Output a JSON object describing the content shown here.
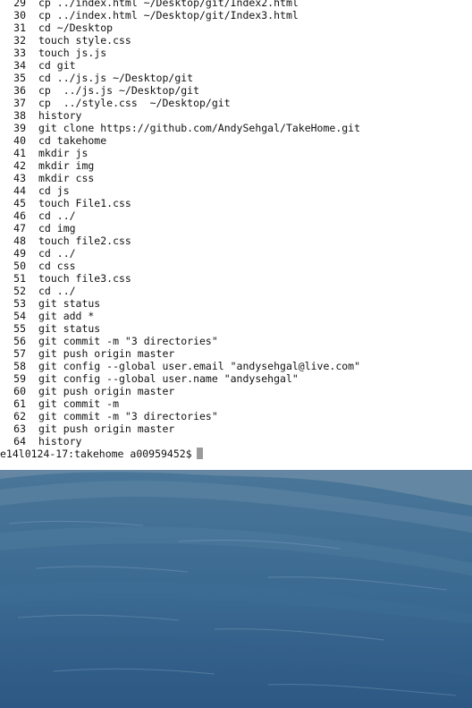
{
  "history": [
    {
      "num": "29",
      "cmd": "cp ../index.html ~/Desktop/git/Index2.html"
    },
    {
      "num": "30",
      "cmd": "cp ../index.html ~/Desktop/git/Index3.html"
    },
    {
      "num": "31",
      "cmd": "cd ~/Desktop"
    },
    {
      "num": "32",
      "cmd": "touch style.css"
    },
    {
      "num": "33",
      "cmd": "touch js.js"
    },
    {
      "num": "34",
      "cmd": "cd git"
    },
    {
      "num": "35",
      "cmd": "cd ../js.js ~/Desktop/git"
    },
    {
      "num": "36",
      "cmd": "cp  ../js.js ~/Desktop/git"
    },
    {
      "num": "37",
      "cmd": "cp  ../style.css  ~/Desktop/git"
    },
    {
      "num": "38",
      "cmd": "history"
    },
    {
      "num": "39",
      "cmd": "git clone https://github.com/AndySehgal/TakeHome.git"
    },
    {
      "num": "40",
      "cmd": "cd takehome"
    },
    {
      "num": "41",
      "cmd": "mkdir js"
    },
    {
      "num": "42",
      "cmd": "mkdir img"
    },
    {
      "num": "43",
      "cmd": "mkdir css"
    },
    {
      "num": "44",
      "cmd": "cd js"
    },
    {
      "num": "45",
      "cmd": "touch File1.css"
    },
    {
      "num": "46",
      "cmd": "cd ../"
    },
    {
      "num": "47",
      "cmd": "cd img"
    },
    {
      "num": "48",
      "cmd": "touch file2.css"
    },
    {
      "num": "49",
      "cmd": "cd ../"
    },
    {
      "num": "50",
      "cmd": "cd css"
    },
    {
      "num": "51",
      "cmd": "touch file3.css"
    },
    {
      "num": "52",
      "cmd": "cd ../"
    },
    {
      "num": "53",
      "cmd": "git status"
    },
    {
      "num": "54",
      "cmd": "git add *"
    },
    {
      "num": "55",
      "cmd": "git status"
    },
    {
      "num": "56",
      "cmd": "git commit -m \"3 directories\""
    },
    {
      "num": "57",
      "cmd": "git push origin master"
    },
    {
      "num": "58",
      "cmd": "git config --global user.email \"andysehgal@live.com\""
    },
    {
      "num": "59",
      "cmd": "git config --global user.name \"andysehgal\""
    },
    {
      "num": "60",
      "cmd": "git push origin master"
    },
    {
      "num": "61",
      "cmd": "git commit -m"
    },
    {
      "num": "62",
      "cmd": "git commit -m \"3 directories\""
    },
    {
      "num": "63",
      "cmd": "git push origin master"
    },
    {
      "num": "64",
      "cmd": "history"
    }
  ],
  "prompt": "e14l0124-17:takehome a00959452$",
  "colors": {
    "terminal_bg": "#ffffff",
    "terminal_text": "#111111",
    "cursor": "#9a9a9a",
    "desktop_water": "#3a6a92"
  }
}
